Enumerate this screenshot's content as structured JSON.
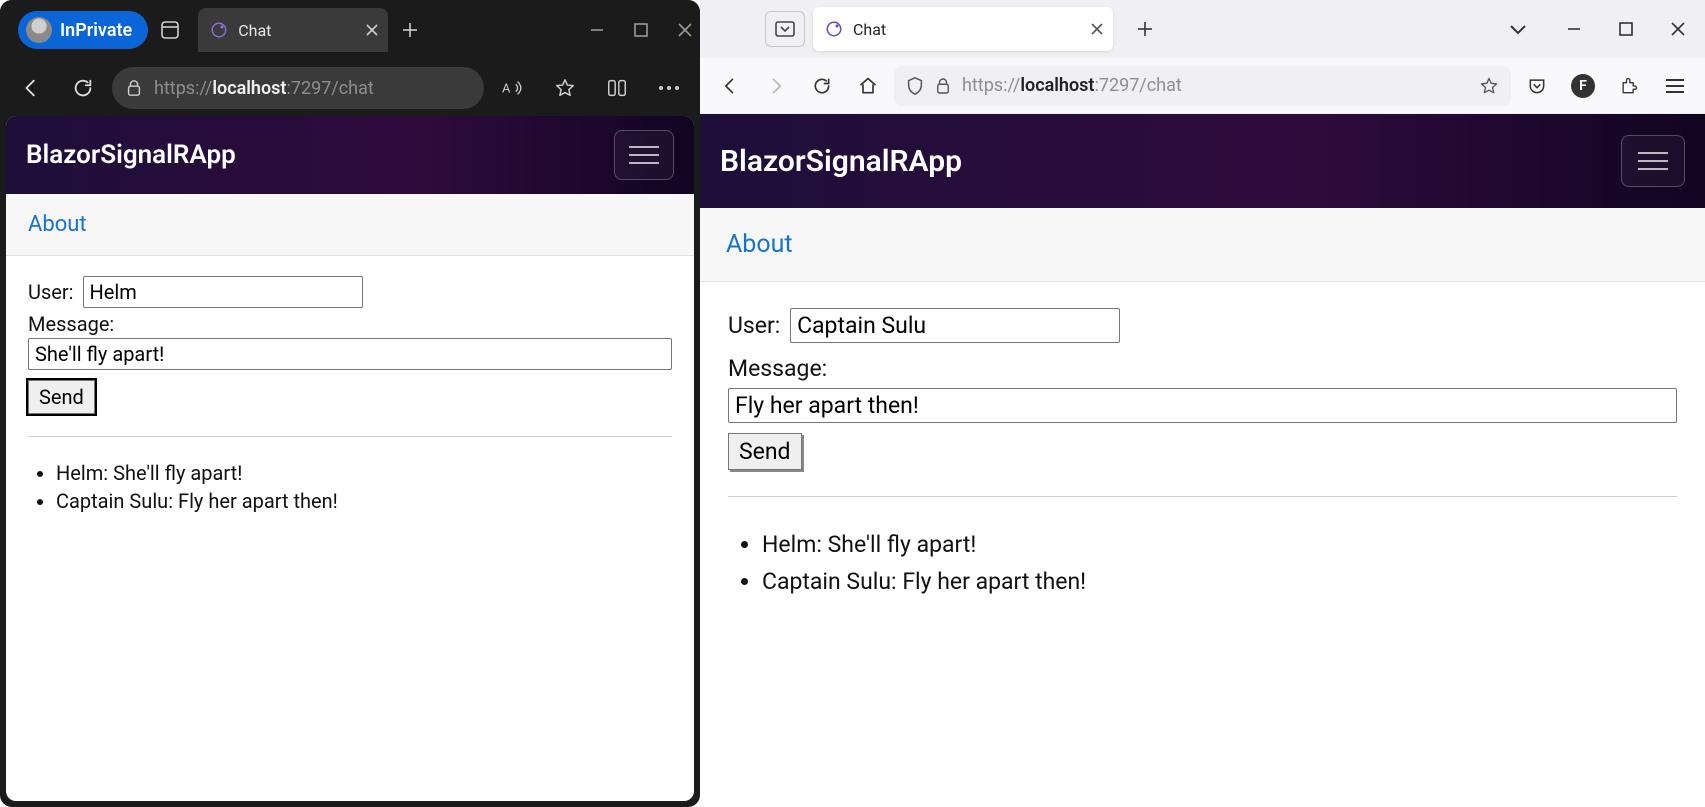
{
  "left": {
    "browser": {
      "inprivate_label": "InPrivate",
      "tab_title": "Chat",
      "url_scheme": "https://",
      "url_host": "localhost",
      "url_port_path": ":7297/chat"
    },
    "app": {
      "title": "BlazorSignalRApp",
      "about_label": "About",
      "user_label": "User:",
      "user_value": "Helm",
      "message_label": "Message:",
      "message_value": "She'll fly apart!",
      "send_label": "Send",
      "messages": [
        "Helm: She'll fly apart!",
        "Captain Sulu: Fly her apart then!"
      ]
    }
  },
  "right": {
    "browser": {
      "tab_title": "Chat",
      "url_scheme": "https://",
      "url_host": "localhost",
      "url_port_path": ":7297/chat",
      "profile_letter": "F"
    },
    "app": {
      "title": "BlazorSignalRApp",
      "about_label": "About",
      "user_label": "User:",
      "user_value": "Captain Sulu",
      "message_label": "Message:",
      "message_value": "Fly her apart then!",
      "send_label": "Send",
      "messages": [
        "Helm: She'll fly apart!",
        "Captain Sulu: Fly her apart then!"
      ]
    }
  }
}
